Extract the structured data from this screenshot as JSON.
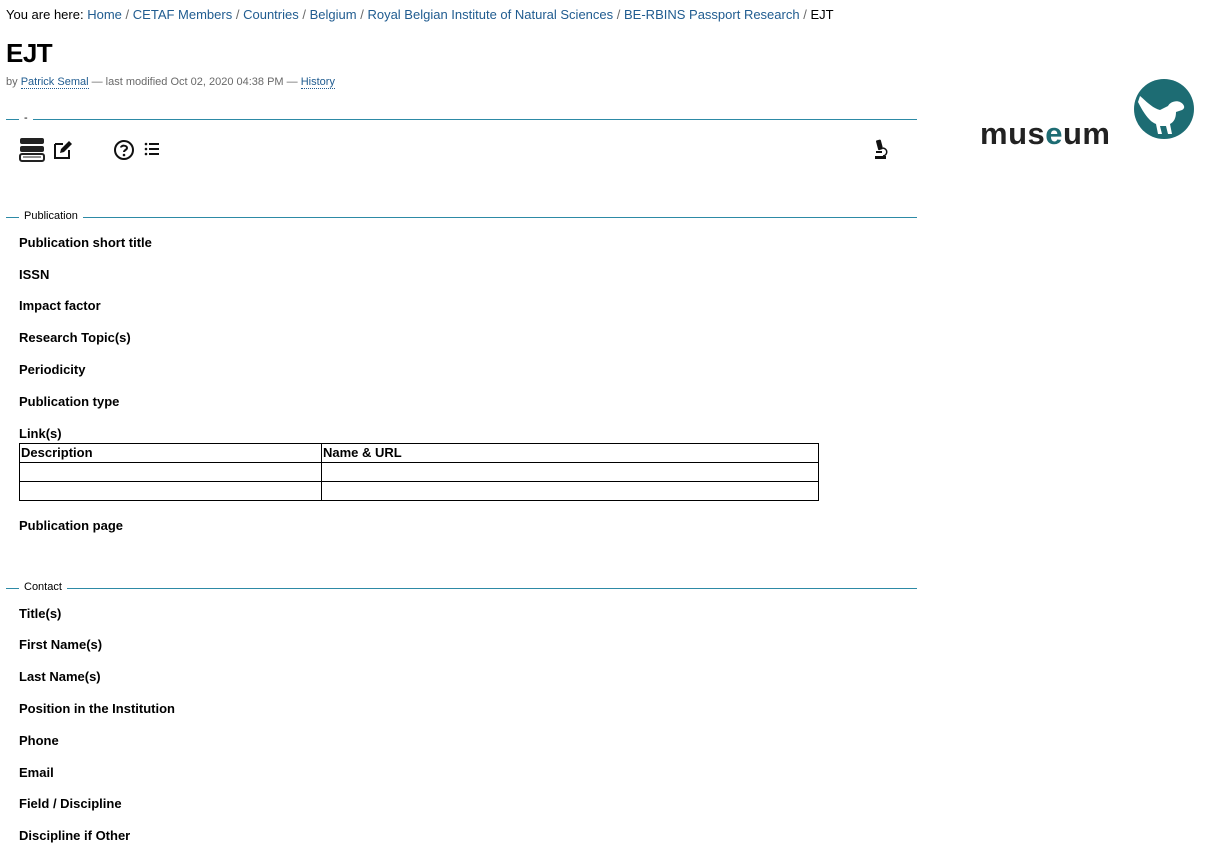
{
  "breadcrumb": {
    "prefix": "You are here:",
    "items": [
      "Home",
      "CETAF Members",
      "Countries",
      "Belgium",
      "Royal Belgian Institute of Natural Sciences",
      "BE-RBINS Passport Research"
    ],
    "current": "EJT",
    "separator": "/"
  },
  "page": {
    "title": "EJT"
  },
  "byline": {
    "by": "by",
    "author": "Patrick Semal",
    "modified": "— last modified Oct 02, 2020 04:38 PM —",
    "history": "History"
  },
  "logo": {
    "text": "museum"
  },
  "toolbar": {
    "legend": "-",
    "icons": [
      "books-icon",
      "edit-icon",
      "help-icon",
      "list-icon",
      "microscope-icon"
    ]
  },
  "publication": {
    "legend": "Publication",
    "fields": [
      "Publication short title",
      "ISSN",
      "Impact factor",
      "Research Topic(s)",
      "Periodicity",
      "Publication type",
      "Link(s)",
      "Publication page"
    ],
    "links_table": {
      "headers": [
        "Description",
        "Name & URL"
      ],
      "rows": [
        [
          "",
          ""
        ],
        [
          "",
          ""
        ]
      ]
    }
  },
  "contact": {
    "legend": "Contact",
    "fields": [
      "Title(s)",
      "First Name(s)",
      "Last Name(s)",
      "Position in the Institution",
      "Phone",
      "Email",
      "Field / Discipline",
      "Discipline if Other"
    ]
  },
  "colors": {
    "link": "#205c90",
    "rule": "#2d8aa6",
    "logo_teal": "#1d6c73",
    "logo_dark": "#222222"
  }
}
